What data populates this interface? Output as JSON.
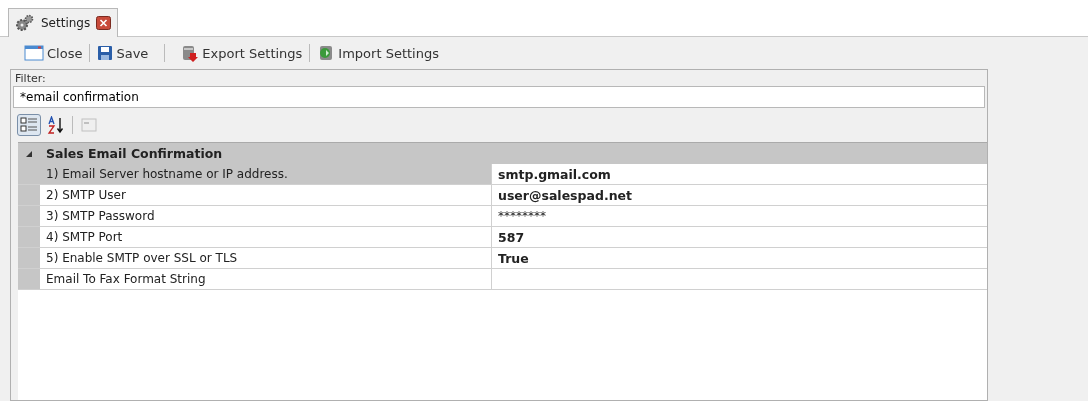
{
  "tabs": [
    {
      "label": "Settings",
      "selected": true
    }
  ],
  "toolbar": [
    {
      "kind": "close",
      "label": "Close"
    },
    {
      "kind": "save",
      "label": "Save"
    },
    {
      "kind": "export",
      "label": "Export Settings"
    },
    {
      "kind": "import",
      "label": "Import Settings"
    }
  ],
  "filter": {
    "label": "Filter:",
    "value": "*email confirmation"
  },
  "grid_toolbar": [
    {
      "kind": "categorized",
      "selected": true,
      "disabled": false
    },
    {
      "kind": "alphabetical",
      "selected": false,
      "disabled": false
    },
    {
      "kind": "pages",
      "selected": false,
      "disabled": true
    }
  ],
  "category": {
    "title": "Sales Email Confirmation",
    "expanded": true,
    "rows": [
      {
        "name": "1) Email Server hostname or IP address.",
        "value": "smtp.gmail.com",
        "modified": true,
        "selected": true
      },
      {
        "name": "2) SMTP User",
        "value": "user@salespad.net",
        "modified": true,
        "selected": false
      },
      {
        "name": "3) SMTP Password",
        "value": "********",
        "modified": false,
        "selected": false
      },
      {
        "name": "4) SMTP Port",
        "value": "587",
        "modified": true,
        "selected": false
      },
      {
        "name": "5) Enable SMTP over SSL or TLS",
        "value": "True",
        "modified": true,
        "selected": false
      },
      {
        "name": "Email To Fax Format String",
        "value": "",
        "modified": false,
        "selected": false
      }
    ]
  }
}
